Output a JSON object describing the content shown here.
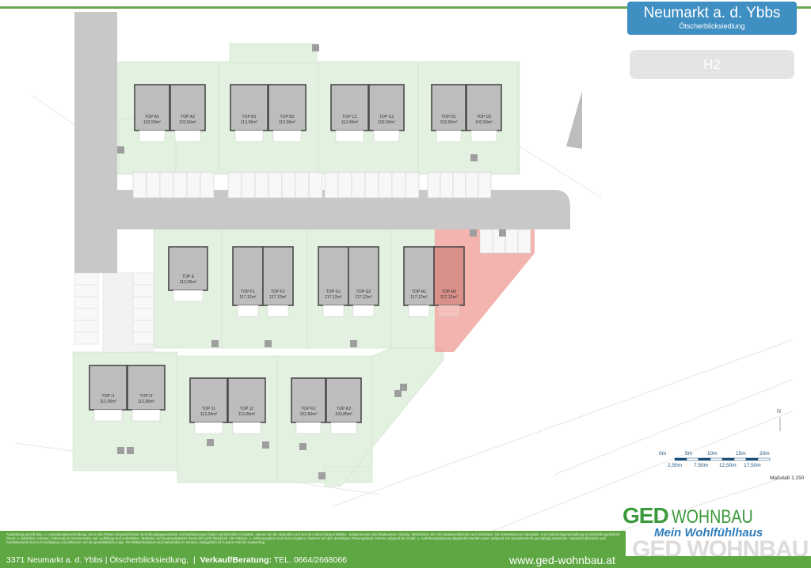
{
  "header": {
    "title": "Neumarkt a. d. Ybbs",
    "subtitle": "Ötscherblicksiedlung",
    "unit_label": "H2"
  },
  "colors": {
    "accent_green": "#5ea743",
    "plot_green": "#e3f1e0",
    "road_gray": "#c8c8c8",
    "building_gray": "#bdbdbd",
    "highlight_red": "#f0a09a",
    "title_blue": "#3f8fc2"
  },
  "highlighted_unit": "TOP H2",
  "map": {
    "units": [
      {
        "id": "A1",
        "label": "TOP A1",
        "area": "102,50m²"
      },
      {
        "id": "A2",
        "label": "TOP A2",
        "area": "102,50m²"
      },
      {
        "id": "B1",
        "label": "TOP B1",
        "area": "112,06m²"
      },
      {
        "id": "B2",
        "label": "TOP B2",
        "area": "112,06m²"
      },
      {
        "id": "C1",
        "label": "TOP C1",
        "area": "112,06m²"
      },
      {
        "id": "C2",
        "label": "TOP C2",
        "area": "102,50m²"
      },
      {
        "id": "D1",
        "label": "TOP D1",
        "area": "102,50m²"
      },
      {
        "id": "D2",
        "label": "TOP D2",
        "area": "102,50m²"
      },
      {
        "id": "E",
        "label": "TOP E",
        "area": "112,06m²"
      },
      {
        "id": "F1",
        "label": "TOP F1",
        "area": "117,12m²"
      },
      {
        "id": "F2",
        "label": "TOP F2",
        "area": "117,12m²"
      },
      {
        "id": "G1",
        "label": "TOP G1",
        "area": "117,12m²"
      },
      {
        "id": "G2",
        "label": "TOP G2",
        "area": "117,12m²"
      },
      {
        "id": "H1",
        "label": "TOP H1",
        "area": "117,12m²"
      },
      {
        "id": "H2",
        "label": "TOP H2",
        "area": "117,12m²"
      },
      {
        "id": "I1",
        "label": "TOP I1",
        "area": "112,06m²"
      },
      {
        "id": "I2",
        "label": "TOP I2",
        "area": "112,06m²"
      },
      {
        "id": "J1",
        "label": "TOP J1",
        "area": "112,06m²"
      },
      {
        "id": "J2",
        "label": "TOP J2",
        "area": "112,06m²"
      },
      {
        "id": "K1",
        "label": "TOP K1",
        "area": "102,50m²"
      },
      {
        "id": "K2",
        "label": "TOP K2",
        "area": "103,85m²"
      }
    ],
    "north_label": "N"
  },
  "scale": {
    "top_labels": [
      "0m",
      "5m",
      "10m",
      "15m",
      "20m"
    ],
    "bottom_labels": [
      "2,50m",
      "7,50m",
      "12,50m",
      "17,50m"
    ],
    "massstab": "Maßstab 1:250"
  },
  "logo": {
    "brand_bold": "GED",
    "brand_rest": "WOHNBAU",
    "tagline": "Mein Wohlfühlhaus",
    "ghost": "GED WOHNBAU"
  },
  "footer": {
    "disclaimer": "Ausstattung gemäß Bau- u. Ausstattungsbeschreibung. Die in den Plänen eingezeichneten Einrichtungsgegenstände und Bepflanzungen haben symbolhaften Charakter, ebenso wie die Illustration und sind im Lieferumfang enthalten - ausgenommen sind Badewanne, Dusche, Waschtisch, WC mit Handwaschbecken und Heizkörper. Die Darstellung der Spielplatz- und Außenanlagengestaltung ist ebenfalls symbolhaft. Druck- u. Satzfehler, Irrtümer, Änderung der Küchenmaße und -aufteilung sind vorbehalten. Statische und bauphysikalische Detail sind nicht Planinhalt. Alle Flächen- u. Höhenangaben sind Circa-Angaben, basieren auf dem derzeitigen Planungsstand, können aufgrund der Detail- u. Ausführungsplanung abgeändert werden sowie aufgrund von Bauzeitenrecht geringfügig abweichen. Haustechnikfunktion und Sanitärkeramik sind nicht maßgenau und definieren nur die grundsätzliche Lage. Für Möblierbarkeiten sind Naturmaße zu nehmen, Maßgeblich ist in jedem Fall der Kaufvertrag.",
    "address": "3371 Neumarkt a. d. Ybbs  |  Ötscherblicksiedlung,",
    "sales_label": "Verkauf/Beratung:",
    "sales_phone": "TEL. 0664/2668066",
    "website": "www.ged-wohnbau.at"
  }
}
